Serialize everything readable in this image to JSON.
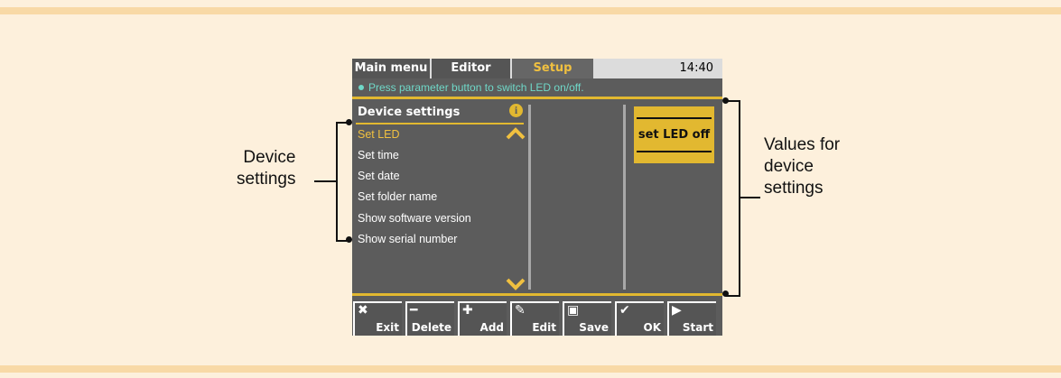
{
  "tabs": {
    "main_menu": "Main menu",
    "editor": "Editor",
    "setup": "Setup",
    "clock": "14:40"
  },
  "hint": "Press parameter button to switch LED on/off.",
  "list": {
    "header": "Device settings",
    "items": [
      {
        "label": "Set LED",
        "selected": true
      },
      {
        "label": "Set time"
      },
      {
        "label": "Set date"
      },
      {
        "label": "Set folder name"
      },
      {
        "label": "Show software version"
      },
      {
        "label": "Show serial number"
      }
    ]
  },
  "value_box": {
    "text": "set LED off"
  },
  "softkeys": [
    {
      "label": "Exit",
      "icon": "x-icon"
    },
    {
      "label": "Delete",
      "icon": "minus-icon"
    },
    {
      "label": "Add",
      "icon": "plus-icon"
    },
    {
      "label": "Edit",
      "icon": "edit-icon"
    },
    {
      "label": "Save",
      "icon": "save-icon"
    },
    {
      "label": "OK",
      "icon": "check-icon"
    },
    {
      "label": "Start",
      "icon": "play-icon"
    }
  ],
  "annotations": {
    "left": [
      "Device",
      "settings"
    ],
    "right": [
      "Values for",
      "device",
      "settings"
    ]
  },
  "colors": {
    "accent": "#e2b830",
    "screen_bg": "#5c5c5c",
    "hint_text": "#6fd8c8",
    "page_bg": "#fdf0dc"
  }
}
